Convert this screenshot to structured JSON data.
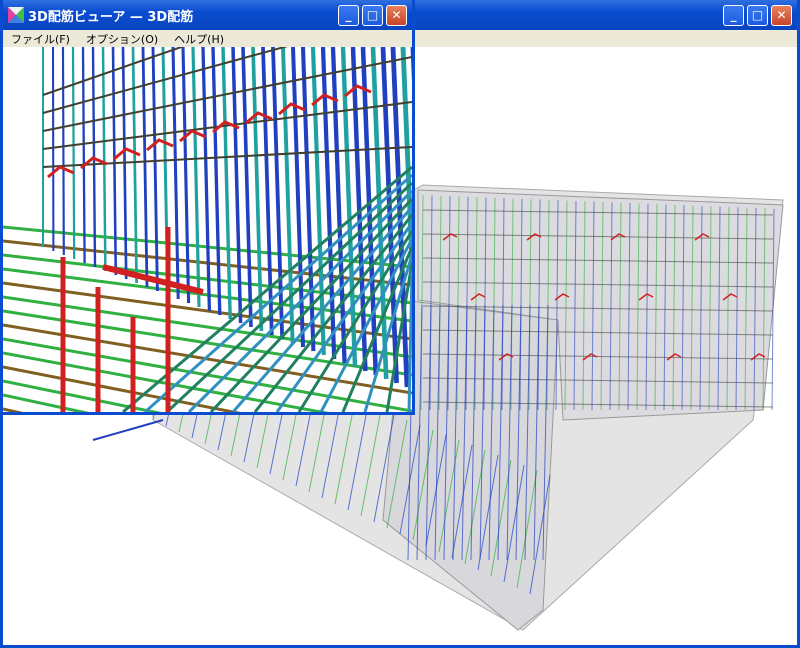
{
  "viewer_window": {
    "title": "3D配筋ビューア — 3D配筋",
    "menu": [
      "ファイル(F)",
      "オプション(O)",
      "ヘルプ(H)"
    ],
    "buttons": {
      "minimize": "_",
      "maximize": "□",
      "close": "✕"
    }
  },
  "main_window": {
    "buttons": {
      "minimize": "_",
      "maximize": "□",
      "close": "✕"
    }
  },
  "colors": {
    "titlebar": "#0a4cd0",
    "menubar": "#ece9d8",
    "rebar_blue": "#2040c0",
    "rebar_green": "#30b040",
    "rebar_red": "#d02020",
    "concrete": "#c8c8c8"
  }
}
